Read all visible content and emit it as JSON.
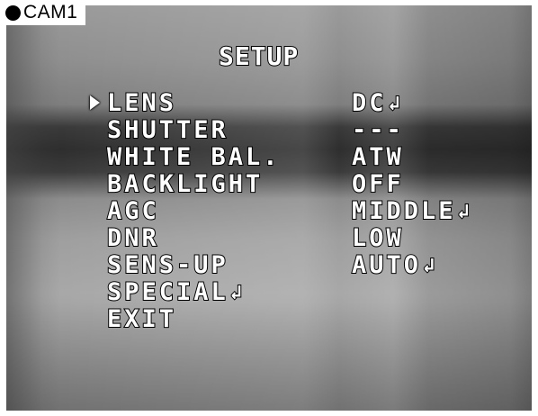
{
  "camera_label": "CAM1",
  "menu_title": "SETUP",
  "enter_glyph": "↲",
  "menu_items": [
    {
      "label": "LENS",
      "value": "DC",
      "has_submenu": true,
      "selected": true
    },
    {
      "label": "SHUTTER",
      "value": "---",
      "has_submenu": false,
      "selected": false
    },
    {
      "label": "WHITE BAL.",
      "value": "ATW",
      "has_submenu": false,
      "selected": false
    },
    {
      "label": "BACKLIGHT",
      "value": "OFF",
      "has_submenu": false,
      "selected": false
    },
    {
      "label": "AGC",
      "value": "MIDDLE",
      "has_submenu": true,
      "selected": false
    },
    {
      "label": "DNR",
      "value": "LOW",
      "has_submenu": false,
      "selected": false
    },
    {
      "label": "SENS-UP",
      "value": "AUTO",
      "has_submenu": true,
      "selected": false
    },
    {
      "label": "SPECIAL",
      "value": "",
      "has_submenu": true,
      "selected": false,
      "label_has_submenu": true
    },
    {
      "label": "EXIT",
      "value": "",
      "has_submenu": false,
      "selected": false
    }
  ],
  "icons": {
    "record_indicator": "filled-circle-icon",
    "selection_pointer": "triangle-right-icon",
    "submenu_enter": "enter-arrow-icon"
  }
}
